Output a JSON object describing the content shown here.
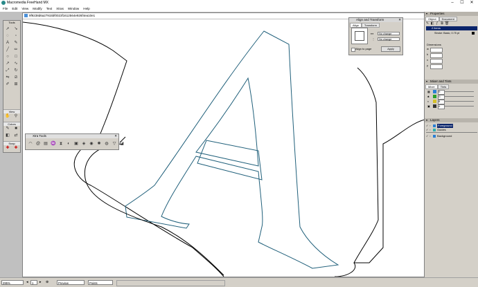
{
  "app": {
    "title": "Macromedia FreeHand MX",
    "window_controls": [
      "–",
      "☐",
      "✕"
    ]
  },
  "menu": [
    "File",
    "Edit",
    "View",
    "Modify",
    "Text",
    "Xtras",
    "Window",
    "Help"
  ],
  "toolbox": {
    "title": "Tools",
    "sections": {
      "view": "View",
      "colors": "Colors",
      "snap": "Snap"
    }
  },
  "document": {
    "title": "9f9238d6a27915bf0023f1612564e926f4ea10e1"
  },
  "xtra_tools": {
    "title": "Xtra Tools"
  },
  "align_panel": {
    "title": "Align and Transform",
    "tabs": [
      "Align",
      "Transform"
    ],
    "horizontal": "No change",
    "vertical": "No change",
    "align_to_page_label": "Align to page",
    "apply": "Apply"
  },
  "properties_panel": {
    "title": "Properties",
    "tabs": [
      "Object",
      "Document"
    ],
    "rows": [
      "2 items",
      "Stroke: Basic, 0.75 pt"
    ],
    "dimensions_label": "Dimensions",
    "dim_fields": [
      "w",
      "h",
      "x",
      "y"
    ]
  },
  "mixer_panel": {
    "title": "Mixer and Tints",
    "tabs": [
      "Mixer",
      "Tints"
    ],
    "channels": [
      "R",
      "G",
      "B",
      "A"
    ]
  },
  "layers_panel": {
    "title": "Layers",
    "layers": [
      "Foreground",
      "Guides",
      "Background"
    ]
  },
  "assets_panel": {
    "title": "Assets"
  },
  "status": {
    "zoom": "295%",
    "page": "1",
    "view_mode": "Preview",
    "units": "Points"
  },
  "colors": {
    "outline": "#1f5f7a",
    "highlight": "#0a246a",
    "panel": "#d4d0c8"
  }
}
